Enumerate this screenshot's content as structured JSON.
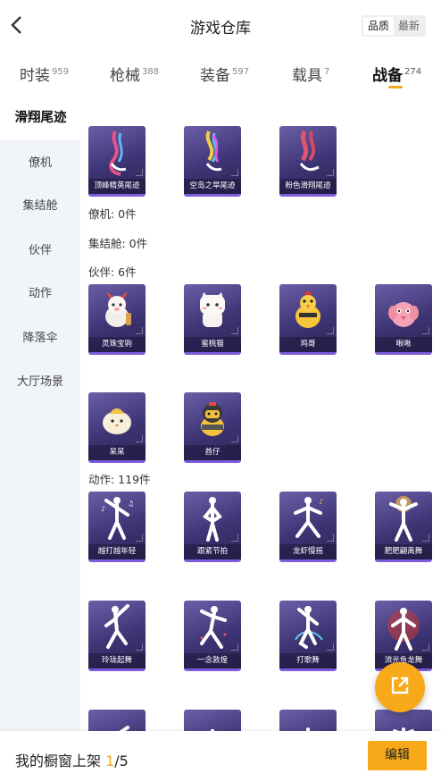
{
  "header": {
    "title": "游戏仓库",
    "sort_quality": "品质",
    "sort_latest": "最新"
  },
  "tabs": [
    {
      "label": "时装",
      "count": "959"
    },
    {
      "label": "枪械",
      "count": "388"
    },
    {
      "label": "装备",
      "count": "597"
    },
    {
      "label": "载具",
      "count": "7"
    },
    {
      "label": "战备",
      "count": "274"
    }
  ],
  "sidebar": [
    {
      "label": "滑翔尾迹"
    },
    {
      "label": "僚机"
    },
    {
      "label": "集结舱"
    },
    {
      "label": "伙伴"
    },
    {
      "label": "动作"
    },
    {
      "label": "降落伞"
    },
    {
      "label": "大厅场景"
    }
  ],
  "trails": [
    {
      "name": "顶峰精英尾迹"
    },
    {
      "name": "空岛之旱尾迹"
    },
    {
      "name": "粉色滑翔尾迹"
    }
  ],
  "sections": {
    "wingman": "僚机: 0件",
    "pod": "集结舱: 0件",
    "partner": "伙伴: 6件",
    "emote": "动作: 119件"
  },
  "partners": [
    {
      "name": "灵珠宝驹"
    },
    {
      "name": "蜜桃猫"
    },
    {
      "name": "鸡哥"
    },
    {
      "name": "啾啾"
    },
    {
      "name": "呆呆"
    },
    {
      "name": "酋仔"
    }
  ],
  "emotes": [
    {
      "name": "越打越年轻"
    },
    {
      "name": "跟紧节拍"
    },
    {
      "name": "龙虾慢摇"
    },
    {
      "name": "肥肥翩离舞"
    },
    {
      "name": "玲珑起舞"
    },
    {
      "name": "一念敦煌"
    },
    {
      "name": "打歌舞"
    },
    {
      "name": "流光鱼龙舞"
    }
  ],
  "bottom": {
    "label_prefix": "我的橱窗上架 ",
    "current": "1",
    "total": "/5",
    "edit": "编辑"
  },
  "colors": {
    "accent": "#f7a91a",
    "card": "#4a3f86",
    "sidebar": "#f1f4f8"
  },
  "icons": {
    "back": "back-chevron-icon",
    "share": "external-link-icon"
  }
}
